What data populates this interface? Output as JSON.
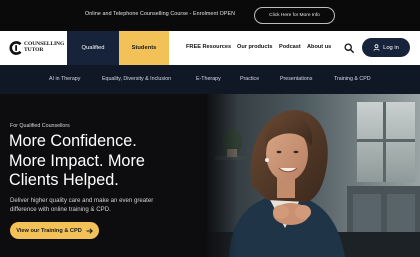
{
  "announcement": {
    "text": "Online and Telephone Counselling Course - Enrolment OPEN",
    "button_label": "Click Here for More Info"
  },
  "brand": {
    "line1": "COUNSELLING",
    "line2": "TUTOR"
  },
  "audience_tabs": [
    {
      "label": "Qualified"
    },
    {
      "label": "Students"
    }
  ],
  "nav": {
    "items": [
      {
        "label": "FREE Resources"
      },
      {
        "label": "Our products"
      },
      {
        "label": "Podcast"
      },
      {
        "label": "About us"
      }
    ],
    "login_label": "Log in"
  },
  "subnav": {
    "items": [
      {
        "label": "AI in Therapy"
      },
      {
        "label": "Equality, Diversity & Inclusion"
      },
      {
        "label": "E-Therapy"
      },
      {
        "label": "Practice"
      },
      {
        "label": "Presentations"
      },
      {
        "label": "Training & CPD"
      }
    ]
  },
  "hero": {
    "eyebrow": "For Qualified Counsellors",
    "headline": [
      "More Confidence.",
      "More Impact. More",
      "Clients Helped."
    ],
    "subcopy": "Deliver higher quality care and make an even greater  difference with online training & CPD.",
    "cta_label": "View our Training & CPD"
  },
  "colors": {
    "navy": "#17233a",
    "gold": "#f2c157",
    "subnav_bg": "#101826"
  },
  "icons": {
    "search": "search-icon",
    "user": "user-icon",
    "arrow": "arrow-right-icon"
  }
}
